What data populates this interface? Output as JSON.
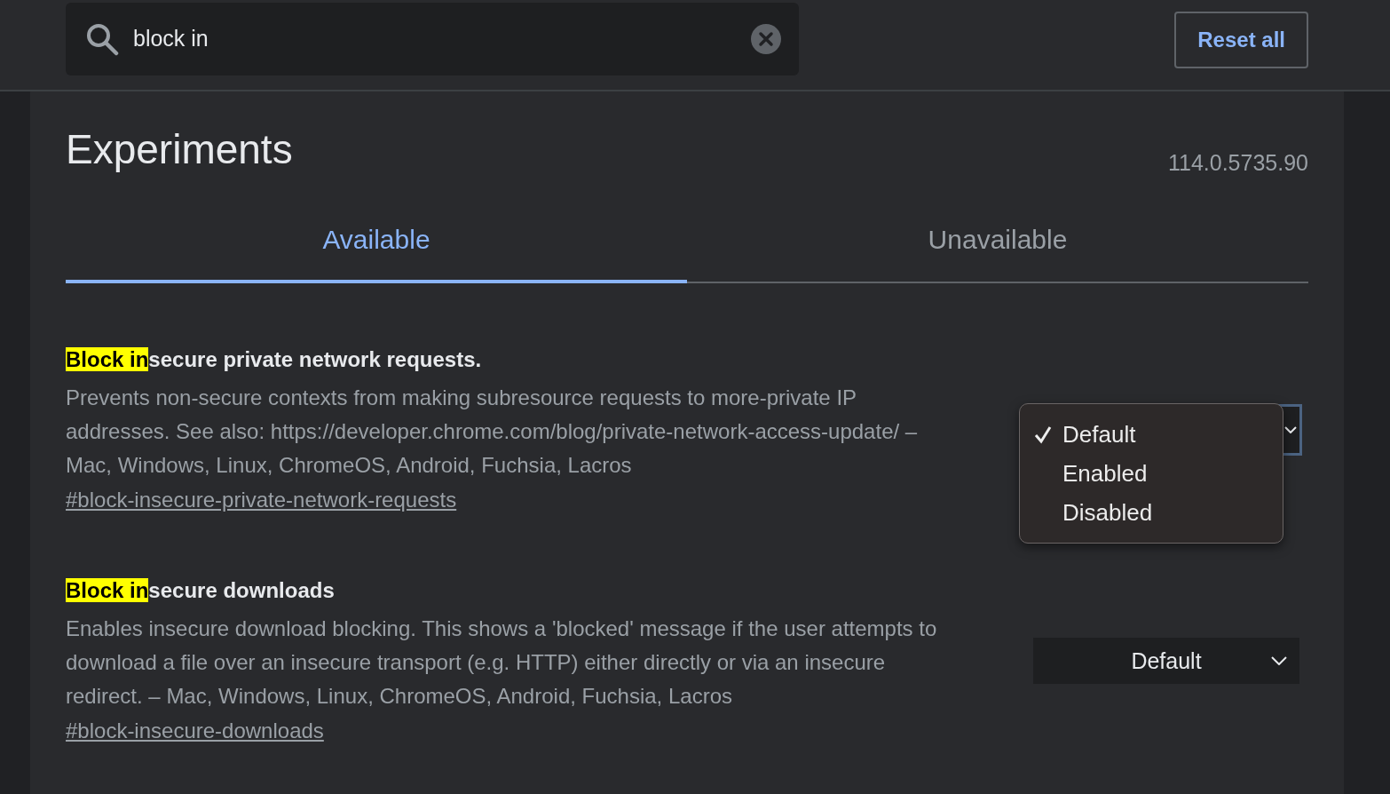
{
  "search": {
    "value": "block in"
  },
  "reset_button": "Reset all",
  "title": "Experiments",
  "version": "114.0.5735.90",
  "tabs": [
    {
      "label": "Available",
      "selected": true
    },
    {
      "label": "Unavailable",
      "selected": false
    }
  ],
  "experiments": [
    {
      "title_match": "Block in",
      "title_rest": "secure private network requests.",
      "description": "Prevents non-secure contexts from making subresource requests to more-private IP addresses. See also: https://developer.chrome.com/blog/private-network-access-update/ – Mac, Windows, Linux, ChromeOS, Android, Fuchsia, Lacros",
      "link": "#block-insecure-private-network-requests",
      "menu": [
        {
          "label": "Default",
          "selected": true
        },
        {
          "label": "Enabled",
          "selected": false
        },
        {
          "label": "Disabled",
          "selected": false
        }
      ]
    },
    {
      "title_match": "Block in",
      "title_rest": "secure downloads",
      "description": "Enables insecure download blocking. This shows a 'blocked' message if the user attempts to download a file over an insecure transport (e.g. HTTP) either directly or via an insecure redirect. – Mac, Windows, Linux, ChromeOS, Android, Fuchsia, Lacros",
      "link": "#block-insecure-downloads",
      "select": "Default"
    }
  ]
}
